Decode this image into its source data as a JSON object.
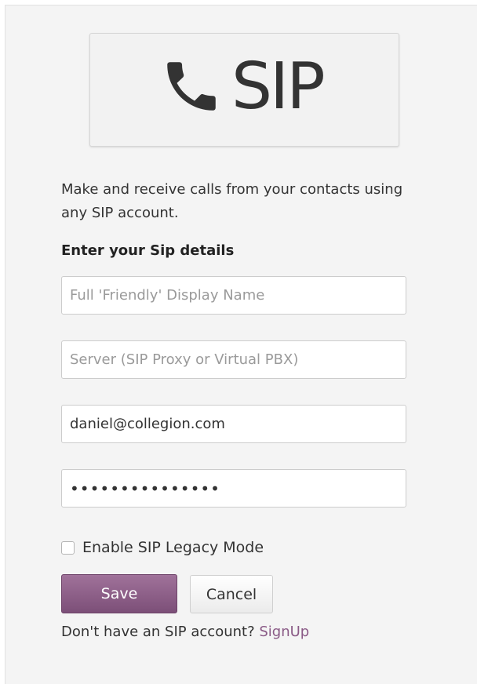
{
  "logo": {
    "text": "SIP",
    "icon": "phone-icon"
  },
  "description": "Make and receive calls from your contacts using any SIP account.",
  "section_title": "Enter your Sip details",
  "fields": {
    "display_name": {
      "value": "",
      "placeholder": "Full 'Friendly' Display Name"
    },
    "server": {
      "value": "",
      "placeholder": "Server (SIP Proxy or Virtual PBX)"
    },
    "username": {
      "value": "daniel@collegion.com",
      "placeholder": ""
    },
    "password": {
      "value": "•••••••••••••••",
      "placeholder": ""
    }
  },
  "legacy_mode": {
    "label": "Enable SIP Legacy Mode",
    "checked": false
  },
  "buttons": {
    "save": "Save",
    "cancel": "Cancel"
  },
  "signup": {
    "prompt": "Don't have an SIP account?",
    "link": "SignUp"
  },
  "colors": {
    "accent": "#8a5a86",
    "save_button": "#8d6089",
    "background": "#f4f4f4"
  }
}
